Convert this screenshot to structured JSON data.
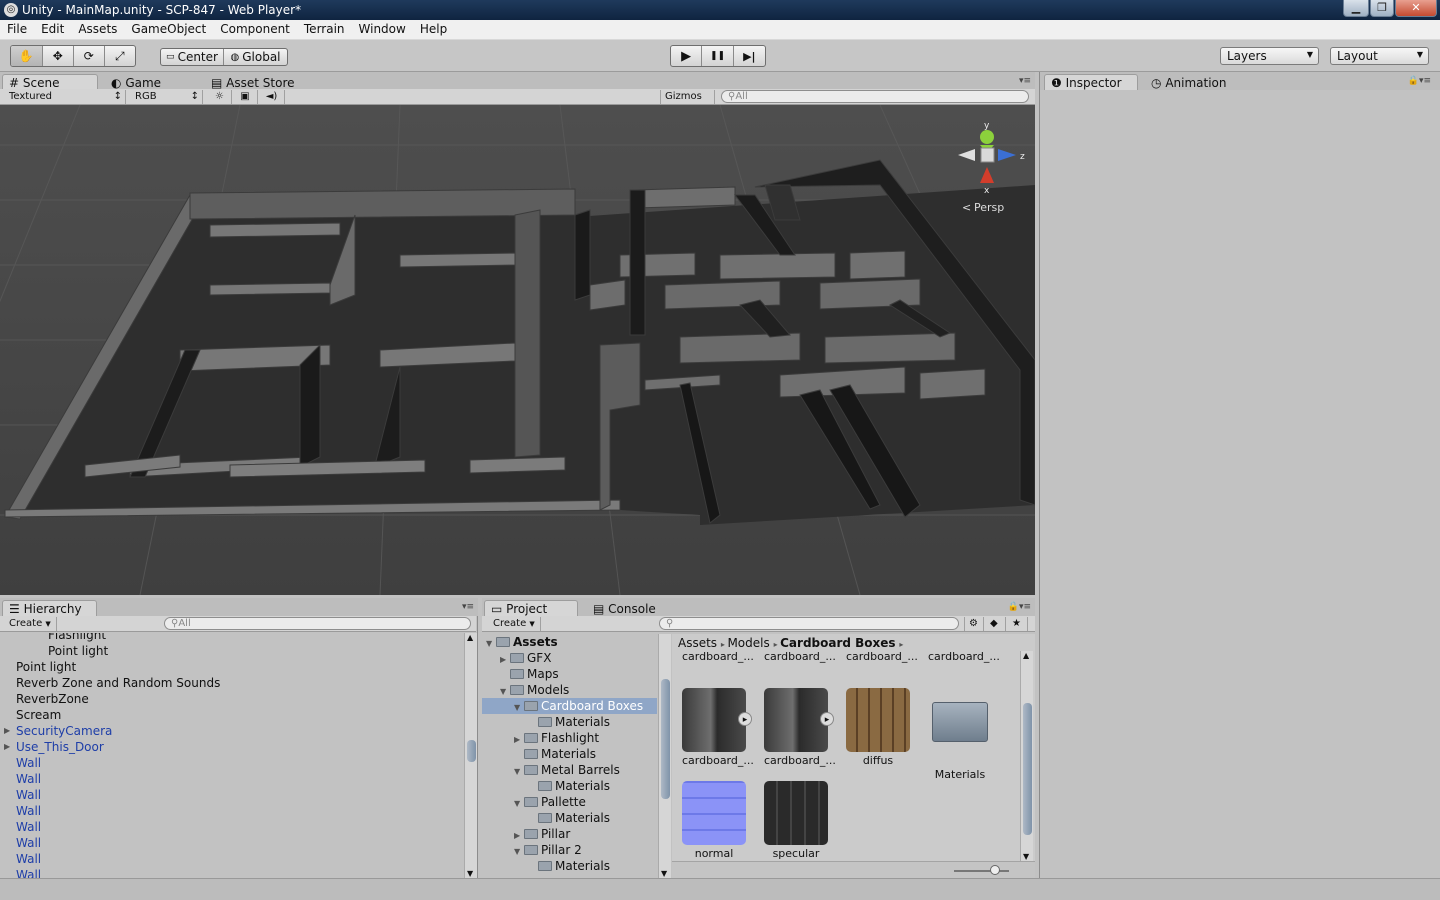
{
  "window": {
    "title": "Unity - MainMap.unity - SCP-847 - Web Player*",
    "min": "▁",
    "max": "❐",
    "close": "✕"
  },
  "menu": [
    "File",
    "Edit",
    "Assets",
    "GameObject",
    "Component",
    "Terrain",
    "Window",
    "Help"
  ],
  "toolbar": {
    "tools": [
      "hand-icon",
      "move-icon",
      "rotate-icon",
      "scale-icon"
    ],
    "tools_glyphs": [
      "✋",
      "✥",
      "⟳",
      "⤢"
    ],
    "pivot": "Center",
    "space": "Global",
    "play_glyphs": [
      "▶",
      "❚❚",
      "▶|"
    ],
    "layers": "Layers",
    "layout": "Layout"
  },
  "scene_tabs": {
    "scene": "Scene",
    "game": "Game",
    "store": "Asset Store"
  },
  "scene_bar": {
    "render_mode": "Textured",
    "color_mode": "RGB",
    "gizmos": "Gizmos",
    "search_placeholder": "All"
  },
  "gizmo": {
    "y": "y",
    "x": "x",
    "z": "z",
    "persp": "Persp"
  },
  "inspector_tabs": {
    "inspector": "Inspector",
    "animation": "Animation"
  },
  "hierarchy": {
    "tab": "Hierarchy",
    "create": "Create",
    "search_placeholder": "All",
    "items": [
      {
        "label": "Flashlight",
        "depth": 3,
        "blue": false,
        "arrow": false
      },
      {
        "label": "Point light",
        "depth": 3,
        "blue": false,
        "arrow": false
      },
      {
        "label": "Point light",
        "depth": 1,
        "blue": false,
        "arrow": false
      },
      {
        "label": "Reverb Zone and Random Sounds",
        "depth": 1,
        "blue": false,
        "arrow": false
      },
      {
        "label": "ReverbZone",
        "depth": 1,
        "blue": false,
        "arrow": false
      },
      {
        "label": "Scream",
        "depth": 1,
        "blue": false,
        "arrow": false
      },
      {
        "label": "SecurityCamera",
        "depth": 1,
        "blue": true,
        "arrow": true
      },
      {
        "label": "Use_This_Door",
        "depth": 1,
        "blue": true,
        "arrow": true
      },
      {
        "label": "Wall",
        "depth": 1,
        "blue": true,
        "arrow": false
      },
      {
        "label": "Wall",
        "depth": 1,
        "blue": true,
        "arrow": false
      },
      {
        "label": "Wall",
        "depth": 1,
        "blue": true,
        "arrow": false
      },
      {
        "label": "Wall",
        "depth": 1,
        "blue": true,
        "arrow": false
      },
      {
        "label": "Wall",
        "depth": 1,
        "blue": true,
        "arrow": false
      },
      {
        "label": "Wall",
        "depth": 1,
        "blue": true,
        "arrow": false
      },
      {
        "label": "Wall",
        "depth": 1,
        "blue": true,
        "arrow": false
      },
      {
        "label": "Wall",
        "depth": 1,
        "blue": true,
        "arrow": false
      }
    ]
  },
  "project": {
    "tab": "Project",
    "console_tab": "Console",
    "create": "Create",
    "breadcrumb": [
      "Assets",
      "Models",
      "Cardboard Boxes"
    ],
    "tree": [
      {
        "label": "Assets",
        "depth": 0,
        "open": true,
        "bold": true
      },
      {
        "label": "GFX",
        "depth": 1,
        "open": false
      },
      {
        "label": "Maps",
        "depth": 1,
        "open": null
      },
      {
        "label": "Models",
        "depth": 1,
        "open": true
      },
      {
        "label": "Cardboard Boxes",
        "depth": 2,
        "open": true,
        "selected": true
      },
      {
        "label": "Materials",
        "depth": 3,
        "open": null
      },
      {
        "label": "Flashlight",
        "depth": 2,
        "open": false
      },
      {
        "label": "Materials",
        "depth": 2,
        "open": null
      },
      {
        "label": "Metal Barrels",
        "depth": 2,
        "open": true
      },
      {
        "label": "Materials",
        "depth": 3,
        "open": null
      },
      {
        "label": "Pallette",
        "depth": 2,
        "open": true
      },
      {
        "label": "Materials",
        "depth": 3,
        "open": null
      },
      {
        "label": "Pillar",
        "depth": 2,
        "open": false
      },
      {
        "label": "Pillar 2",
        "depth": 2,
        "open": true
      },
      {
        "label": "Materials",
        "depth": 3,
        "open": null
      }
    ],
    "top_row": [
      "cardboard_...",
      "cardboard_...",
      "cardboard_...",
      "cardboard_..."
    ],
    "assets": [
      {
        "label": "cardboard_...",
        "kind": "model",
        "color": "#555555"
      },
      {
        "label": "cardboard_...",
        "kind": "model",
        "color": "#555555"
      },
      {
        "label": "diffus",
        "kind": "texture",
        "color": "#7a5a34"
      },
      {
        "label": "Materials",
        "kind": "folder",
        "color": "#7d8a97"
      },
      {
        "label": "normal",
        "kind": "normalmap",
        "color": "#7c86f2"
      },
      {
        "label": "specular",
        "kind": "specular",
        "color": "#252525"
      }
    ]
  }
}
